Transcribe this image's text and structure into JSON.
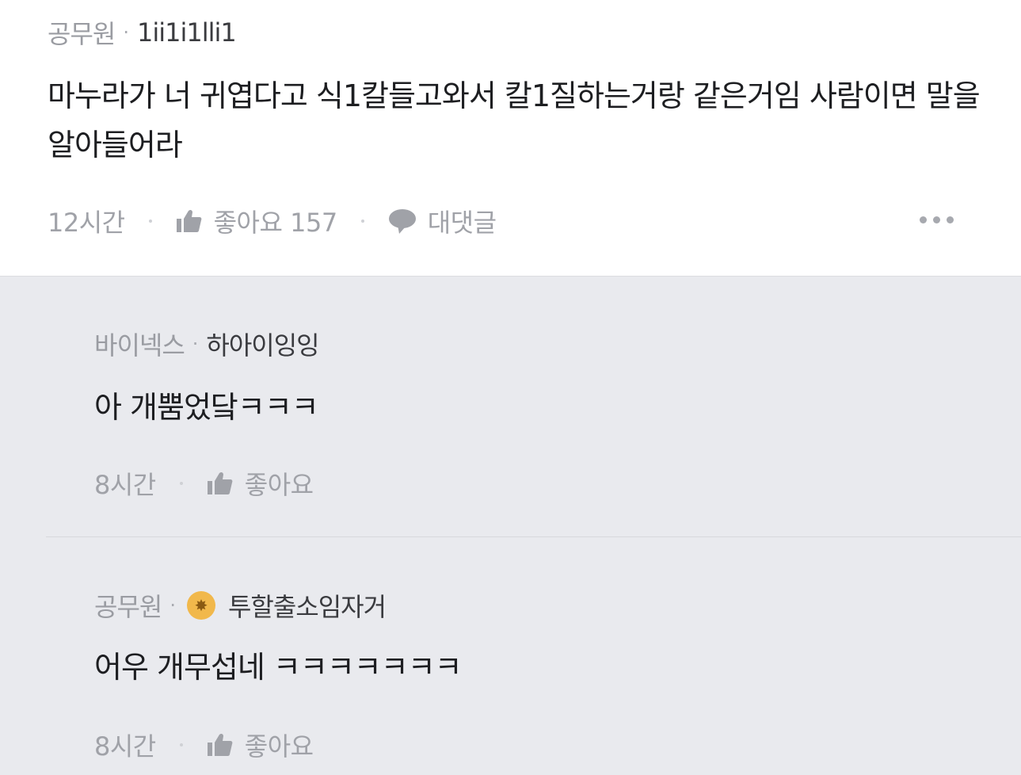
{
  "comment": {
    "company": "공무원",
    "nickname": "1ii1i1lli1",
    "text": "마누라가 너 귀엽다고 식1칼들고와서 칼1질하는거랑 같은거임 사람이면 말을 알아들어라",
    "time": "12시간",
    "like_label": "좋아요 157",
    "reply_label": "대댓글"
  },
  "replies": [
    {
      "company": "바이넥스",
      "nickname": "하아이잉잉",
      "text": "아 개뿜었닼ㅋㅋㅋ",
      "time": "8시간",
      "like_label": "좋아요"
    },
    {
      "company": "공무원",
      "badge_icon": "gold-badge-icon",
      "nickname": "투할출소임자거",
      "text": "어우 개무섭네 ㅋㅋㅋㅋㅋㅋㅋ",
      "time": "8시간",
      "like_label": "좋아요"
    }
  ],
  "colors": {
    "reply_background": "#e9eaee",
    "badge": "#f1b84b"
  }
}
